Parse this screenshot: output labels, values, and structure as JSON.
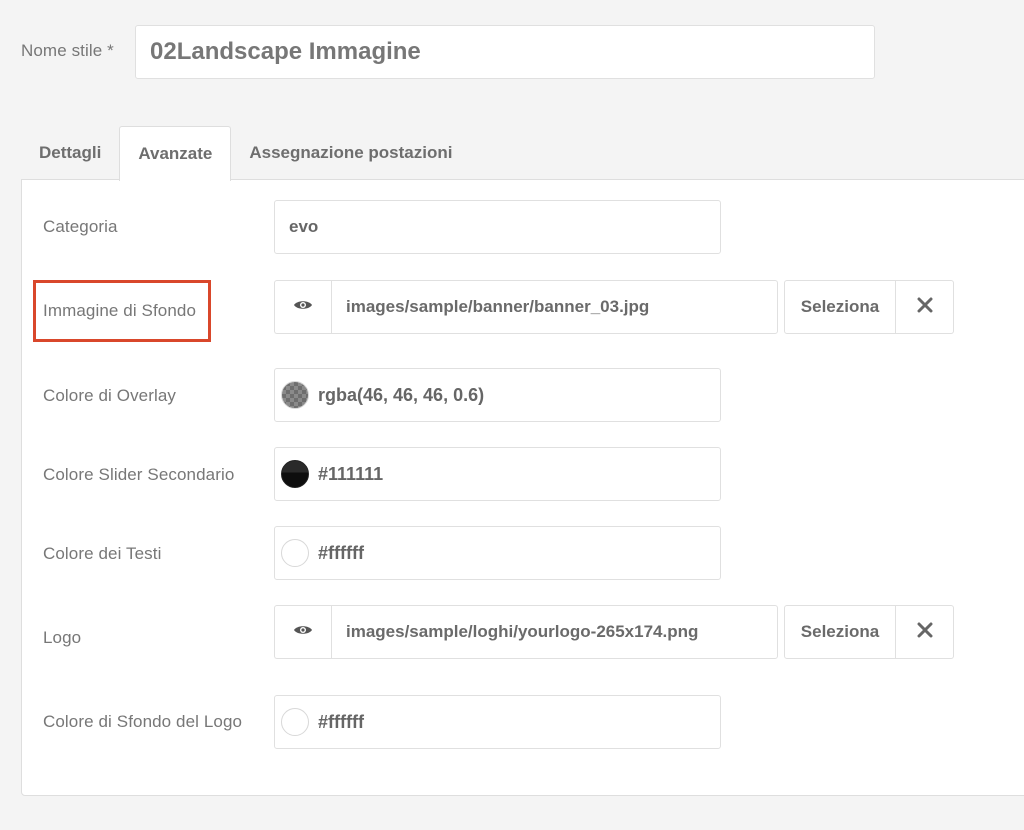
{
  "header": {
    "name_label": "Nome stile *",
    "name_value": "02Landscape Immagine"
  },
  "tabs": [
    {
      "label": "Dettagli",
      "active": false
    },
    {
      "label": "Avanzate",
      "active": true
    },
    {
      "label": "Assegnazione postazioni",
      "active": false
    }
  ],
  "fields": {
    "categoria": {
      "label": "Categoria",
      "value": "evo"
    },
    "immagine_sfondo": {
      "label": "Immagine di Sfondo",
      "value": "images/sample/banner/banner_03.jpg",
      "select_label": "Seleziona"
    },
    "colore_overlay": {
      "label": "Colore di Overlay",
      "value": "rgba(46, 46, 46, 0.6)"
    },
    "colore_slider": {
      "label": "Colore Slider Secondario",
      "value": "#111111"
    },
    "colore_testi": {
      "label": "Colore dei Testi",
      "value": "#ffffff"
    },
    "logo": {
      "label": "Logo",
      "value": "images/sample/loghi/yourlogo-265x174.png",
      "select_label": "Seleziona"
    },
    "colore_sfondo_logo": {
      "label": "Colore di Sfondo del Logo",
      "value": "#ffffff"
    }
  },
  "colors": {
    "highlight": "#d9472b",
    "overlay_swatch": "rgba(46, 46, 46, 0.6)",
    "slider_swatch": "#111111",
    "text_swatch": "#ffffff",
    "logo_bg_swatch": "#ffffff"
  },
  "icons": {
    "preview": "eye-icon",
    "clear": "close-icon"
  }
}
